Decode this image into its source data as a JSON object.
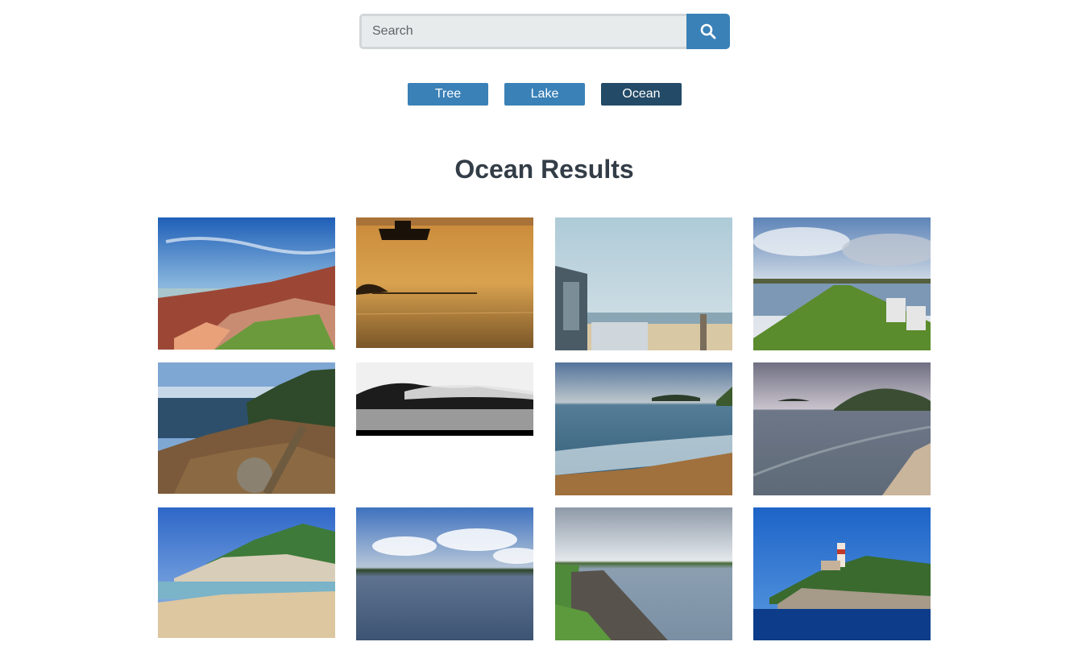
{
  "search": {
    "placeholder": "Search",
    "value": "",
    "button_icon": "search-icon"
  },
  "tags": [
    {
      "label": "Tree",
      "active": false
    },
    {
      "label": "Lake",
      "active": false
    },
    {
      "label": "Ocean",
      "active": true
    }
  ],
  "results": {
    "title": "Ocean Results",
    "photos": [
      "rocky-coast-sunset",
      "boat-golden-sea",
      "beach-from-balcony",
      "grassy-pier",
      "rocky-shore-boardwalk",
      "foggy-island-bw",
      "aerial-beach-waves",
      "cloudy-bay-island",
      "sandy-cove-cliffs",
      "calm-lake-clouds",
      "coastal-inlet",
      "lighthouse-island"
    ]
  },
  "colors": {
    "primary": "#3a81b7",
    "active": "#234a67",
    "title": "#333d47"
  }
}
